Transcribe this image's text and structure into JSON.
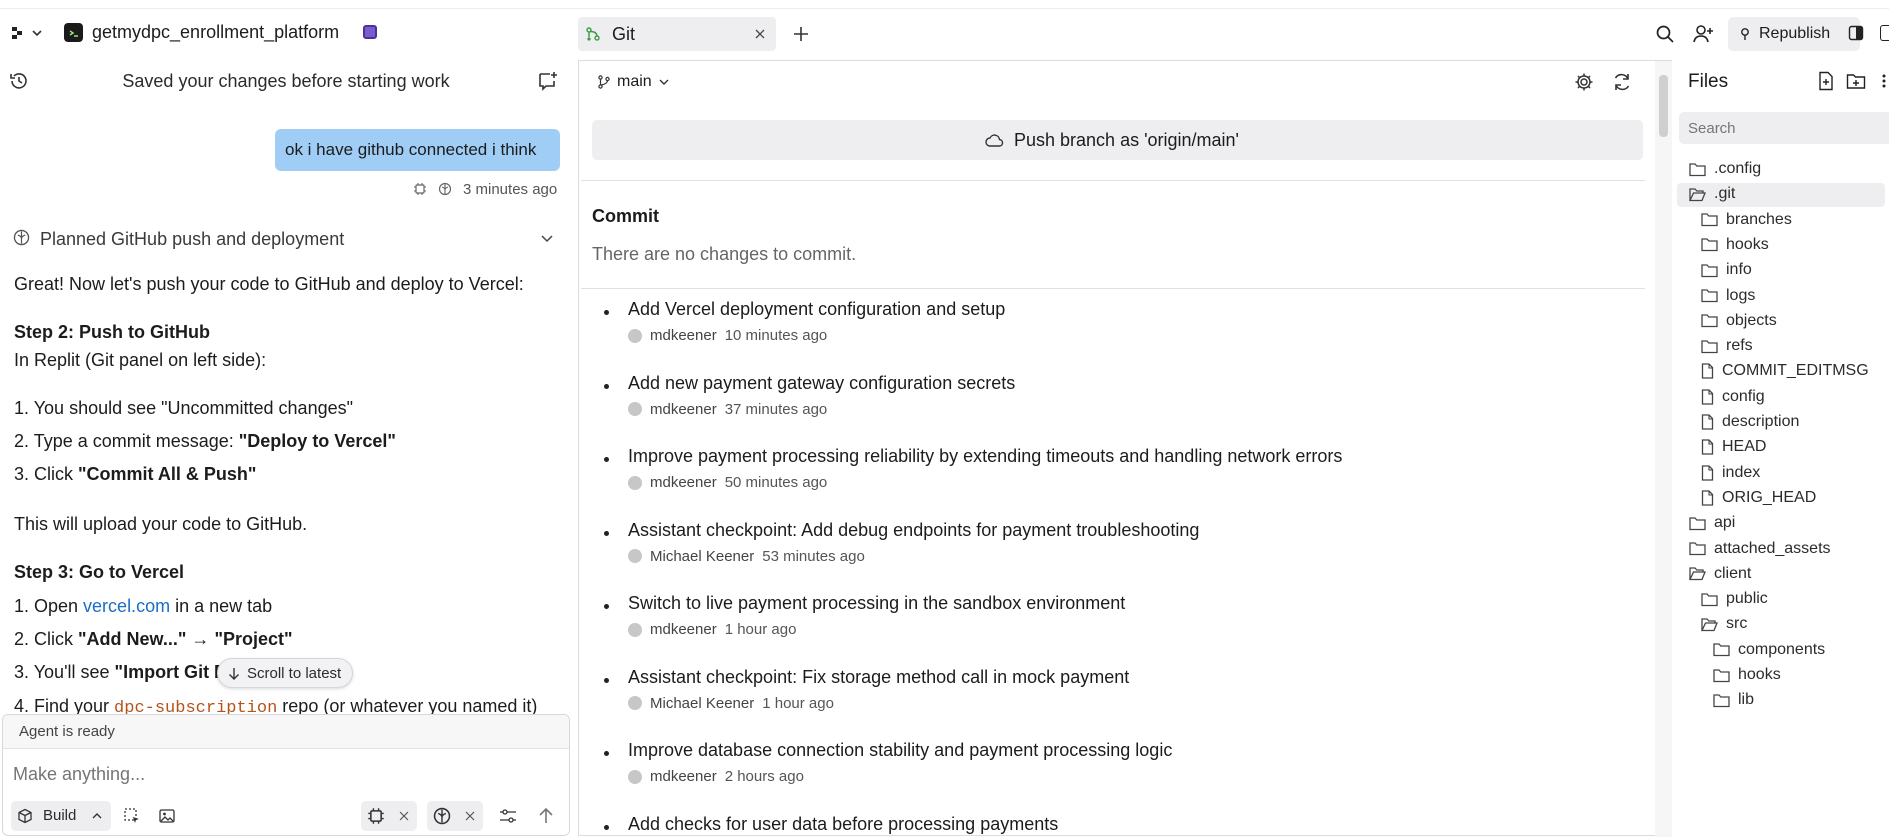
{
  "topbar": {
    "project_name": "getmydpc_enrollment_platform",
    "tab_label": "Git",
    "republish_label": "Republish"
  },
  "chat": {
    "header_title": "Saved your changes before starting work",
    "user_message": "ok i have github connected i think",
    "user_message_time": "3 minutes ago",
    "plan_title": "Planned GitHub push and deployment",
    "lines": {
      "intro": "Great! Now let's push your code to GitHub and deploy to Vercel:",
      "step2_title": "Step 2: Push to GitHub",
      "step2_sub": "In Replit (Git panel on left side):",
      "s2_1": "1. You should see \"Uncommitted changes\"",
      "s2_2_pre": "2. Type a commit message: ",
      "s2_2_bold": "\"Deploy to Vercel\"",
      "s2_3_pre": "3. Click ",
      "s2_3_bold": "\"Commit All & Push\"",
      "upload": "This will upload your code to GitHub.",
      "step3_title": "Step 3: Go to Vercel",
      "s3_1_pre": "1. Open ",
      "s3_1_link": "vercel.com",
      "s3_1_post": " in a new tab",
      "s3_2_pre": "2. Click ",
      "s3_2_bold1": "\"Add New...\"",
      "s3_2_arrow": " → ",
      "s3_2_bold2": "\"Project\"",
      "s3_3_pre": "3. You'll see ",
      "s3_3_bold": "\"Import Git R",
      "s3_4_pre": "4. Find your ",
      "s3_4_code": "dpc-subscription",
      "s3_4_post": " repo (or whatever you named it)"
    },
    "scroll_to_latest": "Scroll to latest",
    "agent_status": "Agent is ready",
    "input_placeholder": "Make anything...",
    "build_label": "Build"
  },
  "git": {
    "branch": "main",
    "push_button": "Push branch as 'origin/main'",
    "commit_heading": "Commit",
    "no_changes": "There are no changes to commit.",
    "commits": [
      {
        "title": "Add Vercel deployment configuration and setup",
        "author": "mdkeener",
        "time": "10 minutes ago"
      },
      {
        "title": "Add new payment gateway configuration secrets",
        "author": "mdkeener",
        "time": "37 minutes ago"
      },
      {
        "title": "Improve payment processing reliability by extending timeouts and handling network errors",
        "author": "mdkeener",
        "time": "50 minutes ago"
      },
      {
        "title": "Assistant checkpoint: Add debug endpoints for payment troubleshooting",
        "author": "Michael Keener",
        "time": "53 minutes ago"
      },
      {
        "title": "Switch to live payment processing in the sandbox environment",
        "author": "mdkeener",
        "time": "1 hour ago"
      },
      {
        "title": "Assistant checkpoint: Fix storage method call in mock payment",
        "author": "Michael Keener",
        "time": "1 hour ago"
      },
      {
        "title": "Improve database connection stability and payment processing logic",
        "author": "mdkeener",
        "time": "2 hours ago"
      },
      {
        "title": "Add checks for user data before processing payments",
        "author": "",
        "time": ""
      }
    ]
  },
  "files": {
    "title": "Files",
    "search_placeholder": "Search",
    "items": [
      {
        "name": ".config",
        "type": "folder"
      },
      {
        "name": ".git",
        "type": "folder-open"
      },
      {
        "name": "branches",
        "type": "folder"
      },
      {
        "name": "hooks",
        "type": "folder"
      },
      {
        "name": "info",
        "type": "folder"
      },
      {
        "name": "logs",
        "type": "folder"
      },
      {
        "name": "objects",
        "type": "folder"
      },
      {
        "name": "refs",
        "type": "folder"
      },
      {
        "name": "COMMIT_EDITMSG",
        "type": "file"
      },
      {
        "name": "config",
        "type": "file"
      },
      {
        "name": "description",
        "type": "file"
      },
      {
        "name": "HEAD",
        "type": "file"
      },
      {
        "name": "index",
        "type": "file"
      },
      {
        "name": "ORIG_HEAD",
        "type": "file"
      },
      {
        "name": "api",
        "type": "folder"
      },
      {
        "name": "attached_assets",
        "type": "folder"
      },
      {
        "name": "client",
        "type": "folder-open"
      },
      {
        "name": "public",
        "type": "folder"
      },
      {
        "name": "src",
        "type": "folder-open"
      },
      {
        "name": "components",
        "type": "folder"
      },
      {
        "name": "hooks",
        "type": "folder"
      },
      {
        "name": "lib",
        "type": "folder"
      }
    ]
  }
}
